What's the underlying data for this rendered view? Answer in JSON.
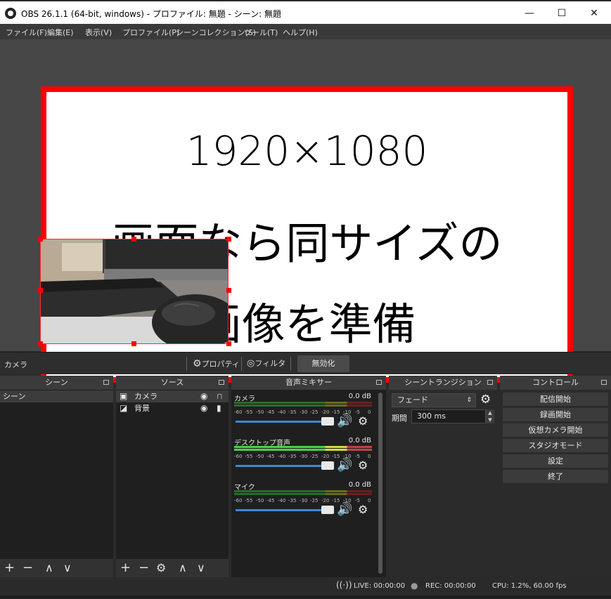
{
  "window": {
    "title": "OBS 26.1.1 (64-bit, windows) - プロファイル: 無題 - シーン: 無題",
    "minimize": "—",
    "maximize": "☐",
    "close": "✕"
  },
  "menu": [
    "ファイル(F)",
    "編集(E)",
    "表示(V)",
    "プロファイル(P)",
    "シーンコレクション(S)",
    "ツール(T)",
    "ヘルプ(H)"
  ],
  "preview": {
    "lines": [
      "1920×1080",
      "画面なら同サイズの",
      "画像を準備"
    ]
  },
  "source_toolbar": {
    "selected_source": "カメラ",
    "properties": "プロパティ",
    "filters": "フィルタ",
    "disable": "無効化"
  },
  "docks": {
    "scenes": {
      "title": "シーン",
      "items": [
        "シーン"
      ]
    },
    "sources": {
      "title": "ソース",
      "items": [
        {
          "label": "カメラ",
          "icon": "camera-icon"
        },
        {
          "label": "背景",
          "icon": "image-icon"
        }
      ]
    },
    "mixer": {
      "title": "音声ミキサー",
      "ticks": [
        "-60",
        "-55",
        "-50",
        "-45",
        "-40",
        "-35",
        "-30",
        "-25",
        "-20",
        "-15",
        "-10",
        "-5",
        "0"
      ],
      "channels": [
        {
          "name": "カメラ",
          "db": "0.0 dB"
        },
        {
          "name": "デスクトップ音声",
          "db": "0.0 dB"
        },
        {
          "name": "マイク",
          "db": "0.0 dB"
        }
      ]
    },
    "transitions": {
      "title": "シーントランジション",
      "selected": "フェード",
      "duration_label": "期間",
      "duration_value": "300 ms"
    },
    "controls": {
      "title": "コントロール",
      "buttons": [
        "配信開始",
        "録画開始",
        "仮想カメラ開始",
        "スタジオモード",
        "設定",
        "終了"
      ]
    }
  },
  "status": {
    "live": "LIVE: 00:00:00",
    "rec": "REC: 00:00:00",
    "cpu": "CPU: 1.2%, 60.00 fps"
  }
}
